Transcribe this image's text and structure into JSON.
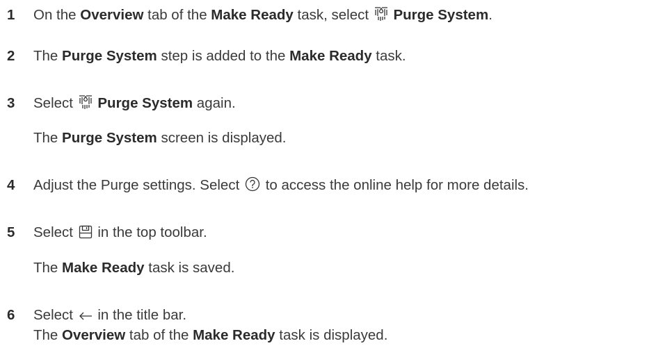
{
  "steps": [
    {
      "number": "1",
      "parts": [
        "On the ",
        "Overview",
        " tab of the ",
        "Make Ready",
        " task, select ",
        "Purge System",
        "."
      ],
      "icon": "purge-system-icon"
    },
    {
      "number": "2",
      "parts": [
        "The ",
        "Purge System",
        " step is added to the ",
        "Make Ready",
        " task."
      ]
    },
    {
      "number": "3",
      "parts": [
        "Select ",
        "Purge System",
        " again."
      ],
      "icon": "purge-system-icon",
      "result": [
        "The ",
        "Purge System",
        " screen is displayed."
      ]
    },
    {
      "number": "4",
      "parts": [
        "Adjust the Purge settings. Select ",
        " to access the online help for more details."
      ],
      "icon": "help-circle-icon"
    },
    {
      "number": "5",
      "parts": [
        "Select ",
        " in the top toolbar."
      ],
      "icon": "save-icon",
      "result": [
        "The ",
        "Make Ready",
        " task is saved."
      ]
    },
    {
      "number": "6",
      "parts": [
        "Select ",
        " in the title bar."
      ],
      "icon": "arrow-left-icon",
      "result": [
        "The ",
        "Overview",
        " tab of the ",
        "Make Ready",
        " task is displayed."
      ]
    }
  ]
}
